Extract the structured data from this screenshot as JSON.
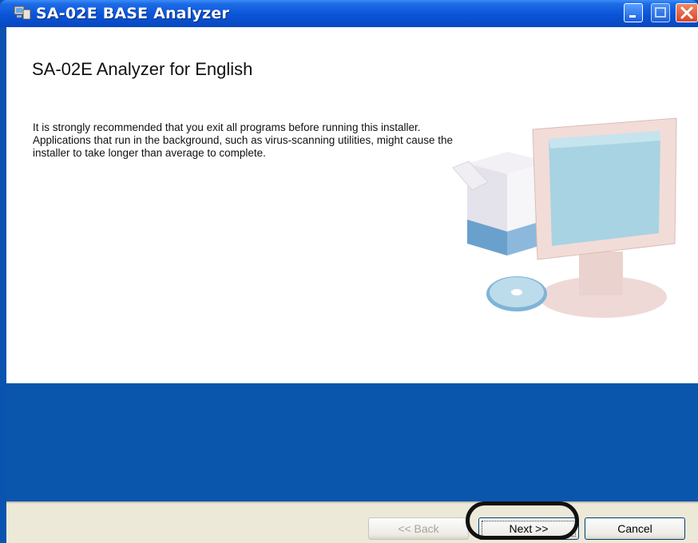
{
  "window": {
    "title": "SA-02E BASE Analyzer",
    "icon": "installer-app-icon",
    "controls": [
      "minimize-icon",
      "maximize-icon",
      "close-icon"
    ]
  },
  "content": {
    "heading": "SA-02E Analyzer for English",
    "intro": "It is strongly recommended that you exit all programs before running this installer. Applications that run in the background, such as virus-scanning utilities, might cause the installer to take longer than average to complete.",
    "illustration": "computer-with-cd-illustration"
  },
  "buttons": {
    "back_label": "<< Back",
    "back_enabled": false,
    "next_label": "Next >>",
    "cancel_label": "Cancel"
  },
  "colors": {
    "titlebar": "#0a54d8",
    "banner": "#0b56ad",
    "button_bar": "#ece9d8",
    "highlight_ring": "#111111"
  }
}
